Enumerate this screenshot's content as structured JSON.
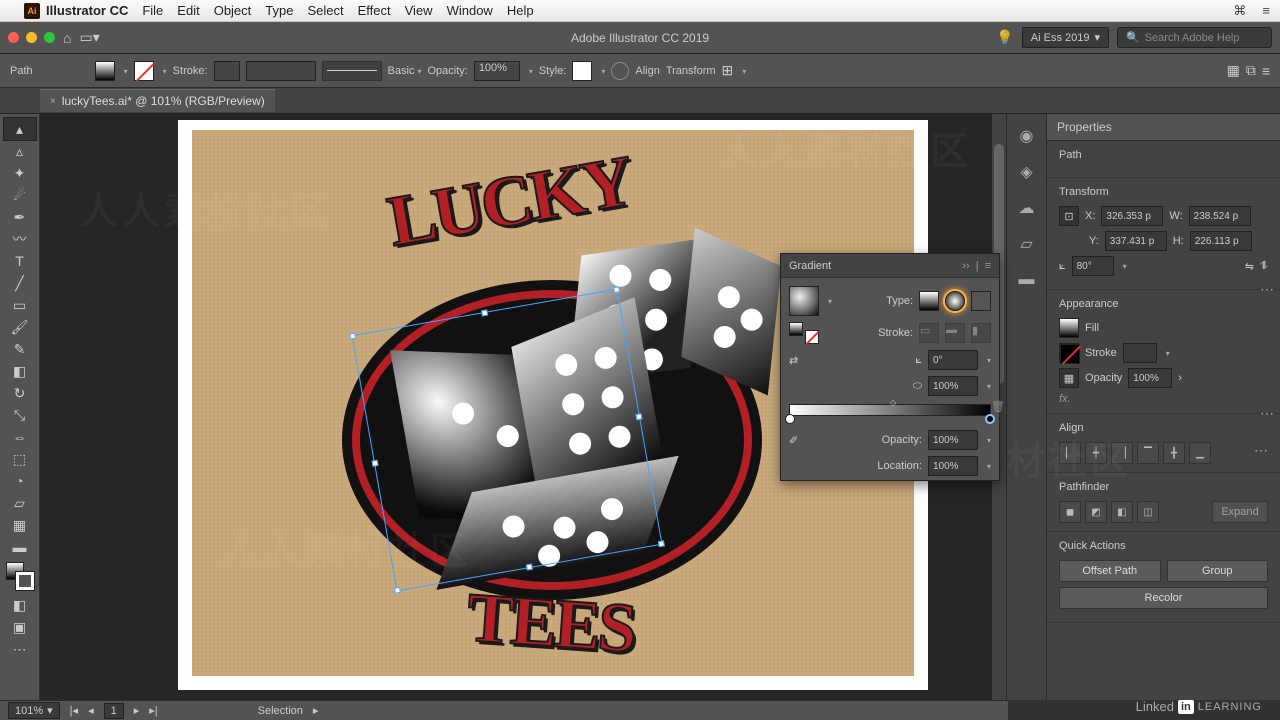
{
  "mac_menu": {
    "app_name": "Illustrator CC",
    "items": [
      "File",
      "Edit",
      "Object",
      "Type",
      "Select",
      "Effect",
      "View",
      "Window",
      "Help"
    ]
  },
  "appbar": {
    "title": "Adobe Illustrator CC 2019",
    "workspace": "Ai Ess 2019",
    "search_placeholder": "Search Adobe Help"
  },
  "control_bar": {
    "selection_label": "Path",
    "stroke_label": "Stroke:",
    "variable_profile": "Basic",
    "opacity_label": "Opacity:",
    "opacity_value": "100%",
    "style_label": "Style:",
    "align_label": "Align",
    "transform_label": "Transform"
  },
  "doc_tab": {
    "name": "luckyTees.ai* @ 101% (RGB/Preview)"
  },
  "art": {
    "word_top": "LUCKY",
    "word_bottom": "TEES"
  },
  "gradient_panel": {
    "title": "Gradient",
    "type_label": "Type:",
    "stroke_label": "Stroke:",
    "angle_value": "0°",
    "aspect_value": "100%",
    "opacity_label": "Opacity:",
    "opacity_value": "100%",
    "location_label": "Location:",
    "location_value": "100%"
  },
  "properties": {
    "tab": "Properties",
    "selection": "Path",
    "transform_title": "Transform",
    "x_label": "X:",
    "x_value": "326.353 p",
    "y_label": "Y:",
    "y_value": "337.431 p",
    "w_label": "W:",
    "w_value": "238.524 p",
    "h_label": "H:",
    "h_value": "226.113 p",
    "angle_value": "80°",
    "appearance_title": "Appearance",
    "fill_label": "Fill",
    "stroke_label": "Stroke",
    "opacity_label": "Opacity",
    "opacity_value": "100%",
    "fx_label": "fx.",
    "align_title": "Align",
    "pathfinder_title": "Pathfinder",
    "expand_label": "Expand",
    "quick_title": "Quick Actions",
    "offset_btn": "Offset Path",
    "group_btn": "Group",
    "recolor_btn": "Recolor"
  },
  "status_bar": {
    "zoom": "101%",
    "artboard_num": "1",
    "mode": "Selection"
  },
  "brand": {
    "linkedin": "Linked",
    "learning": "LEARNING"
  }
}
